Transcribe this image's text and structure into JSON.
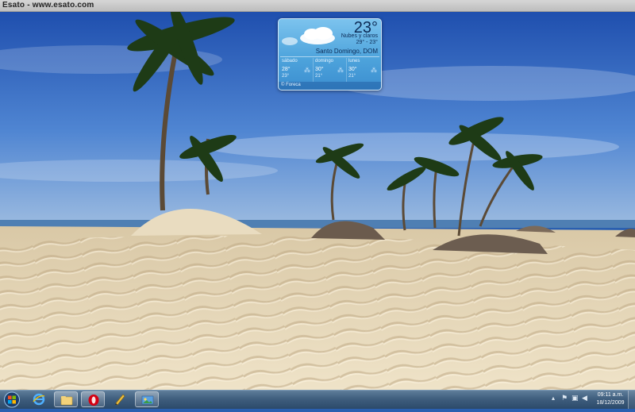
{
  "banner": {
    "title": "Esato - www.esato.com"
  },
  "gadget": {
    "temperature": "23°",
    "condition": "Nubes y claros",
    "range": "29° - 23°",
    "city": "Santo Domingo, DOM",
    "days": [
      {
        "name": "sábado",
        "high": "28°",
        "low": "23°"
      },
      {
        "name": "domingo",
        "high": "30°",
        "low": "21°"
      },
      {
        "name": "lunes",
        "high": "30°",
        "low": "21°"
      }
    ],
    "provider": "© Foreca"
  },
  "taskbar": {
    "apps": [
      {
        "name": "internet-explorer",
        "icon": "internet-explorer-icon",
        "active": false
      },
      {
        "name": "windows-explorer",
        "icon": "folder-icon",
        "active": true
      },
      {
        "name": "opera",
        "icon": "opera-icon",
        "active": true
      },
      {
        "name": "app-gold",
        "icon": "pen-app-icon",
        "active": false
      },
      {
        "name": "app-photo",
        "icon": "photo-app-icon",
        "active": true
      }
    ],
    "tray_icons": [
      "up-arrow-icon",
      "flag-icon",
      "network-icon",
      "speaker-icon"
    ],
    "clock_time": "09:11 a.m.",
    "clock_date": "18/12/2009"
  },
  "wallpaper": {
    "theme": "beach with palm trees and sand dunes",
    "sky": "#3f74c8",
    "sand": "#e6d7b6"
  }
}
